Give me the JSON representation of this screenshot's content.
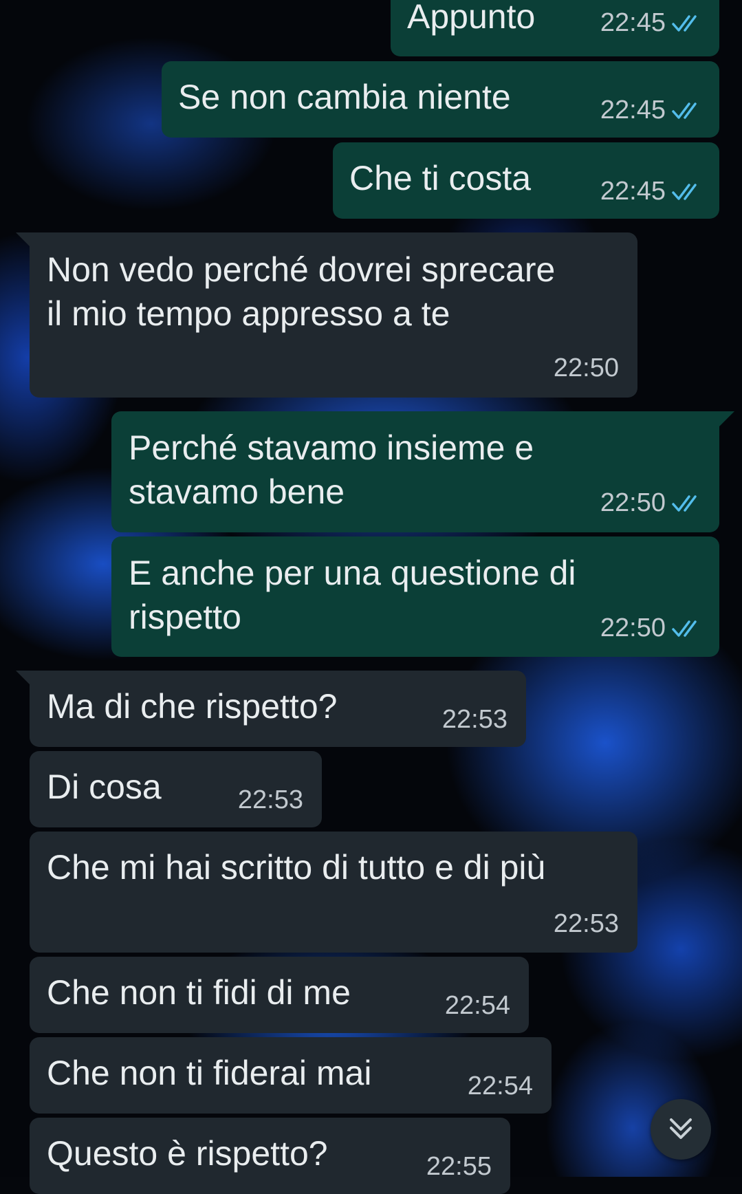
{
  "colors": {
    "outgoing_bubble": "#0b3f37",
    "incoming_bubble": "#20282f",
    "text": "#e9edef",
    "timestamp": "#c2c9cf",
    "read_tick": "#53bdeb",
    "wallpaper_accent": "#2563eb"
  },
  "messages": [
    {
      "direction": "outgoing",
      "text": "Appunto",
      "time": "22:45",
      "status": "read-ticks-icon"
    },
    {
      "direction": "outgoing",
      "text": "Se non cambia niente",
      "time": "22:45",
      "status": "read-ticks-icon"
    },
    {
      "direction": "outgoing",
      "text": "Che ti costa",
      "time": "22:45",
      "status": "read-ticks-icon"
    },
    {
      "direction": "incoming",
      "text": "Non vedo perché dovrei sprecare\nil mio tempo appresso a te",
      "time": "22:50"
    },
    {
      "direction": "outgoing",
      "text": "Perché stavamo insieme e\nstavamo bene",
      "time": "22:50",
      "status": "read-ticks-icon"
    },
    {
      "direction": "outgoing",
      "text": "E anche per una questione di\nrispetto",
      "time": "22:50",
      "status": "read-ticks-icon"
    },
    {
      "direction": "incoming",
      "text": "Ma di che rispetto?",
      "time": "22:53"
    },
    {
      "direction": "incoming",
      "text": "Di cosa",
      "time": "22:53"
    },
    {
      "direction": "incoming",
      "text": "Che mi hai scritto di tutto e di più",
      "time": "22:53"
    },
    {
      "direction": "incoming",
      "text": "Che non ti fidi di me",
      "time": "22:54"
    },
    {
      "direction": "incoming",
      "text": "Che non ti fiderai mai",
      "time": "22:54"
    },
    {
      "direction": "incoming",
      "text": "Questo è rispetto?",
      "time": "22:55"
    }
  ],
  "scroll_button": {
    "icon": "double-chevron-down-icon"
  }
}
